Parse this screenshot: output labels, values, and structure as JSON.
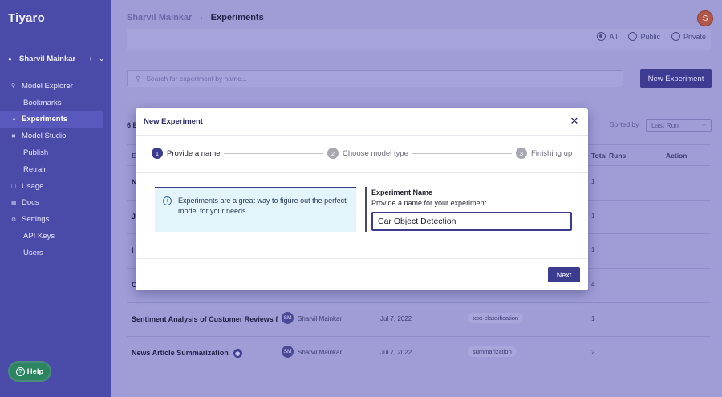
{
  "app": {
    "brand": "Tiyaro"
  },
  "sidebar": {
    "user": "Sharvil Mainkar",
    "items": [
      {
        "label": "Model Explorer",
        "icon": "search-icon"
      },
      {
        "label": "Bookmarks",
        "icon": ""
      },
      {
        "label": "Experiments",
        "icon": "flask-icon",
        "active": true
      },
      {
        "label": "Model Studio",
        "icon": "studio-icon"
      },
      {
        "label": "Publish",
        "icon": ""
      },
      {
        "label": "Retrain",
        "icon": ""
      },
      {
        "label": "Usage",
        "icon": "usage-icon"
      },
      {
        "label": "Docs",
        "icon": "docs-icon"
      },
      {
        "label": "Settings",
        "icon": "gear-icon"
      },
      {
        "label": "API Keys",
        "icon": ""
      },
      {
        "label": "Users",
        "icon": ""
      }
    ],
    "help_label": "Help"
  },
  "header": {
    "breadcrumb_user": "Sharvil Mainkar",
    "breadcrumb_page": "Experiments",
    "avatar_initial": "S"
  },
  "filters": {
    "options": [
      "All",
      "Public",
      "Private"
    ],
    "selected": "All"
  },
  "search": {
    "placeholder": "Search for experiment by name..."
  },
  "toolbar": {
    "new_experiment_label": "New Experiment"
  },
  "list": {
    "count_label": "6 E",
    "sort_label": "Sorted by",
    "sort_value": "Last Run",
    "columns": {
      "first": "E",
      "total_runs": "Total Runs",
      "action": "Action"
    },
    "rows": [
      {
        "name": "N",
        "runs": "1"
      },
      {
        "name": "J",
        "runs": "1"
      },
      {
        "name": "I",
        "runs": "1"
      },
      {
        "name": "C",
        "runs": "4"
      },
      {
        "name": "Sentiment Analysis of Customer Reviews f",
        "owner_initials": "SM",
        "owner": "Sharvil Mainkar",
        "date": "Jul 7, 2022",
        "tag": "text-classification",
        "runs": "1"
      },
      {
        "name": "News Article Summarization",
        "owner_initials": "SM",
        "owner": "Sharvil Mainkar",
        "date": "Jul 7, 2022",
        "tag": "summarization",
        "runs": "2",
        "public": true
      }
    ]
  },
  "modal": {
    "title": "New Experiment",
    "steps": [
      {
        "num": "1",
        "label": "Provide a name"
      },
      {
        "num": "2",
        "label": "Choose model type"
      },
      {
        "num": "3",
        "label": "Finishing up"
      }
    ],
    "info_text": "Experiments are a great way to figure out the perfect model for your needs.",
    "field_title": "Experiment Name",
    "field_desc": "Provide a name for your experiment",
    "field_value": "Car Object Detection",
    "next_label": "Next"
  },
  "colors": {
    "sidebar": "#4a4aa8",
    "accent": "#3b3b8f",
    "overlay": "#9f9cd6",
    "info_bg": "#e4f4fb",
    "help": "#2b8560"
  }
}
